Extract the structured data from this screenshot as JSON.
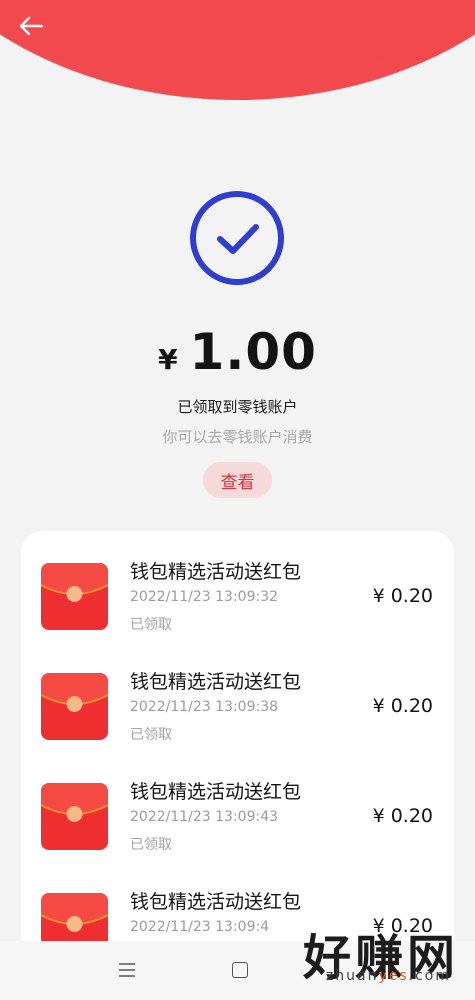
{
  "header": {
    "back_icon": "arrow-left-icon",
    "color": "#f24147"
  },
  "result": {
    "icon": "check-circle-icon",
    "icon_color": "#2f3ecf",
    "currency": "¥",
    "amount": "1.00",
    "status": "已领取到零钱账户",
    "hint": "你可以去零钱账户消费",
    "view_label": "查看"
  },
  "records": [
    {
      "title": "钱包精选活动送红包",
      "time": "2022/11/23 13:09:32",
      "status": "已领取",
      "amount": "¥ 0.20"
    },
    {
      "title": "钱包精选活动送红包",
      "time": "2022/11/23 13:09:38",
      "status": "已领取",
      "amount": "¥ 0.20"
    },
    {
      "title": "钱包精选活动送红包",
      "time": "2022/11/23 13:09:43",
      "status": "已领取",
      "amount": "¥ 0.20"
    },
    {
      "title": "钱包精选活动送红包",
      "time": "2022/11/23 13:09:4",
      "status": "",
      "amount": "¥ 0.20"
    }
  ],
  "nav": {
    "menu_icon": "menu-icon",
    "home_icon": "home-square-icon"
  },
  "watermark": {
    "text": "好赚网",
    "site_prefix": "zhuan",
    "site_highlight": "yes",
    "site_suffix": ".com"
  }
}
